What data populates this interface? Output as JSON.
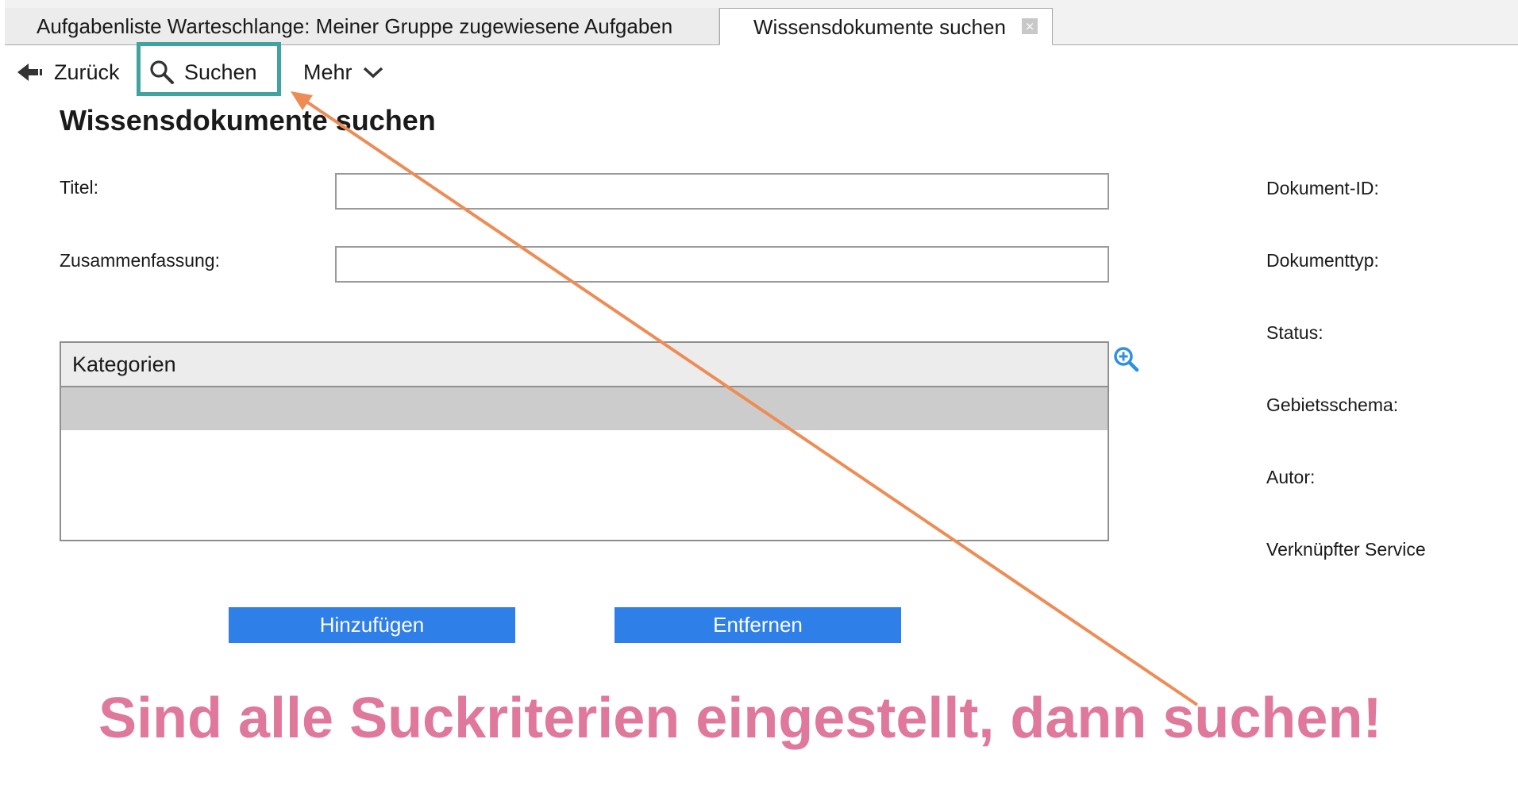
{
  "tabs": [
    {
      "label": "Aufgabenliste Warteschlange: Meiner Gruppe zugewiesene Aufgaben",
      "active": false
    },
    {
      "label": "Wissensdokumente suchen",
      "active": true,
      "close_glyph": "×"
    }
  ],
  "toolbar": {
    "back_label": "Zurück",
    "search_label": "Suchen",
    "more_label": "Mehr"
  },
  "page_title": "Wissensdokumente suchen",
  "form": {
    "title_label": "Titel:",
    "title_value": "",
    "summary_label": "Zusammenfassung:",
    "summary_value": ""
  },
  "categories": {
    "header": "Kategorien",
    "rows": [
      ""
    ]
  },
  "right_fields": [
    "Dokument-ID:",
    "Dokumenttyp:",
    "Status:",
    "Gebietsschema:",
    "Autor:",
    "Verknüpfter Service"
  ],
  "buttons": {
    "add_label": "Hinzufügen",
    "remove_label": "Entfernen"
  },
  "annotation": {
    "text": "Sind alle Suckriterien eingestellt, dann suchen!",
    "text_color": "#e0789b",
    "arrow_color": "#ee8c55",
    "box_color": "#3fa3a0"
  },
  "colors": {
    "button_blue": "#2f7fe8",
    "zoom_icon_blue": "#2f8fe0"
  }
}
